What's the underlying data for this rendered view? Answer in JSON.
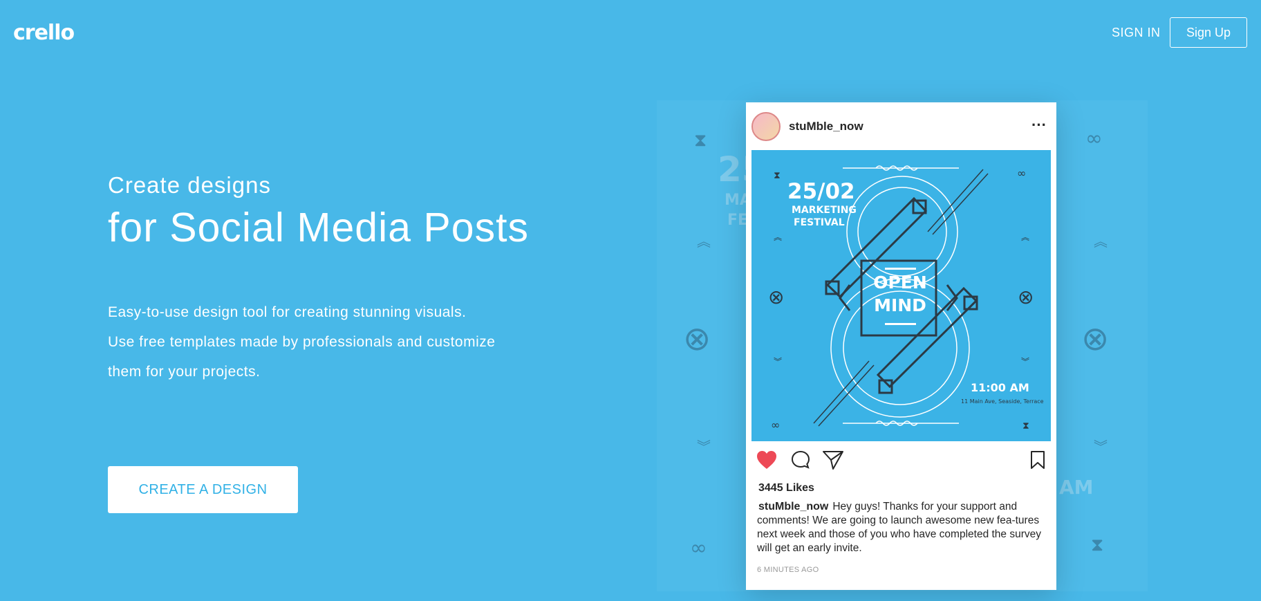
{
  "header": {
    "logo": "crello",
    "sign_in": "SIGN IN",
    "sign_up": "Sign Up"
  },
  "hero": {
    "kicker": "Create designs",
    "title": "for Social Media Posts",
    "description_lines": [
      "Easy-to-use design tool for creating stunning visuals.",
      "Use free templates made by professionals and customize",
      "them for your projects."
    ],
    "cta": "CREATE A DESIGN"
  },
  "background_poster": {
    "partial_texts": [
      "25",
      "MA",
      "FE",
      "AM",
      "11 Main Ave, Seaside, Terrace"
    ]
  },
  "post": {
    "username": "stuMble_now",
    "poster": {
      "date": "25/02",
      "event_line1": "MARKETING",
      "event_line2": "FESTIVAL",
      "headline_line1": "OPEN",
      "headline_line2": "MIND",
      "time": "11:00 AM",
      "address": "11 Main Ave, Seaside, Terrace"
    },
    "likes": "3445 Likes",
    "caption_user": "stuMble_now",
    "caption_text": "Hey guys! Thanks for your support and comments! We are going to launch awesome new fea-tures next week and those of you who have completed the survey will get an early invite.",
    "time_ago": "6 MINUTES AGO"
  },
  "colors": {
    "background": "#48b8e8",
    "accent": "#31b1e6",
    "heart": "#ed4956",
    "poster_bg": "#3bb3e6",
    "poster_lines": "#2b3a45"
  },
  "icons": [
    "heart-icon",
    "comment-icon",
    "share-icon",
    "bookmark-icon",
    "more-icon"
  ]
}
